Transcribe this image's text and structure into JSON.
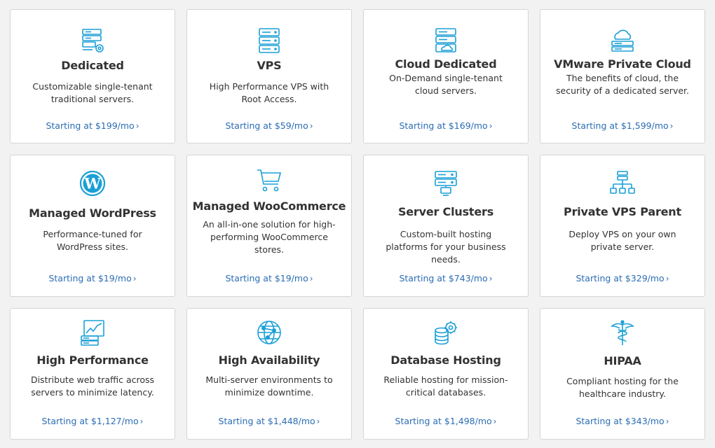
{
  "accent_color": "#1a9fd6",
  "link_color": "#2b6db3",
  "cards": [
    {
      "title": "Dedicated",
      "icon": "server-gear-icon",
      "desc": "Customizable single-tenant traditional servers.",
      "price": "Starting at $199/mo"
    },
    {
      "title": "VPS",
      "icon": "server-stack-icon",
      "desc": "High Performance VPS with Root Access.",
      "price": "Starting at $59/mo"
    },
    {
      "title": "Cloud Dedicated",
      "icon": "cloud-server-icon",
      "desc": "On-Demand single-tenant cloud servers.",
      "price": "Starting at $169/mo"
    },
    {
      "title": "VMware Private Cloud",
      "icon": "cloud-stack-icon",
      "desc": "The benefits of cloud, the security of a dedicated server.",
      "price": "Starting at $1,599/mo"
    },
    {
      "title": "Managed WordPress",
      "icon": "wordpress-icon",
      "desc": "Performance-tuned for WordPress sites.",
      "price": "Starting at $19/mo"
    },
    {
      "title": "Managed WooCommerce",
      "icon": "shopping-cart-icon",
      "desc": "An all-in-one solution for high-performing WooCommerce stores.",
      "price": "Starting at $19/mo"
    },
    {
      "title": "Server Clusters",
      "icon": "server-cluster-icon",
      "desc": "Custom-built hosting platforms for your business needs.",
      "price": "Starting at $743/mo"
    },
    {
      "title": "Private VPS Parent",
      "icon": "network-tree-icon",
      "desc": "Deploy VPS on your own private server.",
      "price": "Starting at $329/mo"
    },
    {
      "title": "High Performance",
      "icon": "performance-chart-icon",
      "desc": "Distribute web traffic across servers to minimize latency.",
      "price": "Starting at $1,127/mo"
    },
    {
      "title": "High Availability",
      "icon": "globe-network-icon",
      "desc": "Multi-server environments to minimize downtime.",
      "price": "Starting at $1,448/mo"
    },
    {
      "title": "Database Hosting",
      "icon": "database-gear-icon",
      "desc": "Reliable hosting for mission-critical databases.",
      "price": "Starting at $1,498/mo"
    },
    {
      "title": "HIPAA",
      "icon": "caduceus-icon",
      "desc": "Compliant hosting for the healthcare industry.",
      "price": "Starting at $343/mo"
    }
  ]
}
